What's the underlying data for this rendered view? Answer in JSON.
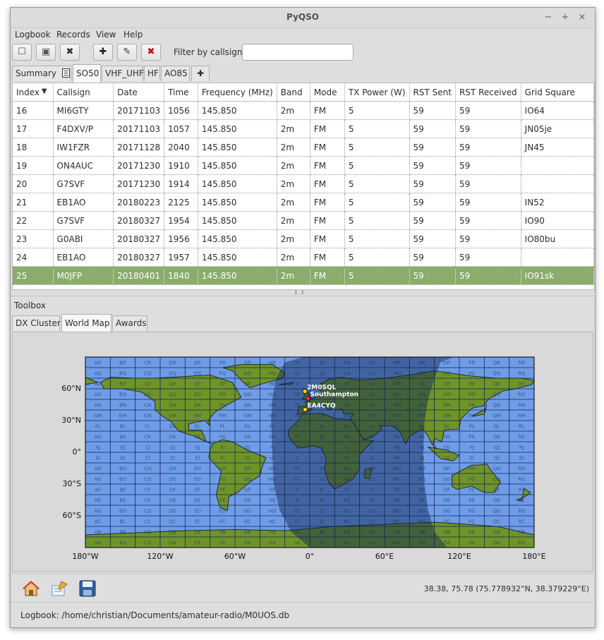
{
  "window": {
    "title": "PyQSO",
    "min_glyph": "−",
    "max_glyph": "+",
    "close_glyph": "×"
  },
  "menubar": {
    "items": [
      "Logbook",
      "Records",
      "View",
      "Help"
    ]
  },
  "toolbar": {
    "buttons": [
      {
        "name": "new-logbook-icon",
        "glyph": "☐",
        "color": "#555555"
      },
      {
        "name": "open-logbook-icon",
        "glyph": "▣",
        "color": "#555555"
      },
      {
        "name": "close-logbook-icon",
        "glyph": "✖",
        "color": "#333333"
      },
      {
        "name": "add-record-icon",
        "glyph": "✚",
        "color": "#222222"
      },
      {
        "name": "edit-record-icon",
        "glyph": "✎",
        "color": "#333333"
      },
      {
        "name": "delete-record-icon",
        "glyph": "✖",
        "color": "#cc0000"
      }
    ],
    "filter_label": "Filter by callsign:",
    "filter_value": ""
  },
  "logbook_tabs": [
    {
      "label": "Summary",
      "has_icon": true,
      "active": false
    },
    {
      "label": "SO50",
      "active": true
    },
    {
      "label": "VHF_UHF",
      "active": false
    },
    {
      "label": "HF",
      "active": false
    },
    {
      "label": "AO85",
      "active": false
    },
    {
      "label": "✚",
      "active": false
    }
  ],
  "table": {
    "sort_indicator": "▼",
    "columns": [
      "Index",
      "Callsign",
      "Date",
      "Time",
      "Frequency (MHz)",
      "Band",
      "Mode",
      "TX Power (W)",
      "RST Sent",
      "RST Received",
      "Grid Square"
    ],
    "rows": [
      [
        "16",
        "MI6GTY",
        "20171103",
        "1056",
        "145.850",
        "2m",
        "FM",
        "5",
        "59",
        "59",
        "IO64"
      ],
      [
        "17",
        "F4DXV/P",
        "20171103",
        "1057",
        "145.850",
        "2m",
        "FM",
        "5",
        "59",
        "59",
        "JN05je"
      ],
      [
        "18",
        "IW1FZR",
        "20171128",
        "2040",
        "145.850",
        "2m",
        "FM",
        "5",
        "59",
        "59",
        "JN45"
      ],
      [
        "19",
        "ON4AUC",
        "20171230",
        "1910",
        "145.850",
        "2m",
        "FM",
        "5",
        "59",
        "59",
        ""
      ],
      [
        "20",
        "G7SVF",
        "20171230",
        "1914",
        "145.850",
        "2m",
        "FM",
        "5",
        "59",
        "59",
        ""
      ],
      [
        "21",
        "EB1AO",
        "20180223",
        "2125",
        "145.850",
        "2m",
        "FM",
        "5",
        "59",
        "59",
        "IN52"
      ],
      [
        "22",
        "G7SVF",
        "20180327",
        "1954",
        "145.850",
        "2m",
        "FM",
        "5",
        "59",
        "59",
        "IO90"
      ],
      [
        "23",
        "G0ABI",
        "20180327",
        "1956",
        "145.850",
        "2m",
        "FM",
        "5",
        "59",
        "59",
        "IO80bu"
      ],
      [
        "24",
        "EB1AO",
        "20180327",
        "1957",
        "145.850",
        "2m",
        "FM",
        "5",
        "59",
        "59",
        ""
      ],
      [
        "25",
        "M0JFP",
        "20180401",
        "1840",
        "145.850",
        "2m",
        "FM",
        "5",
        "59",
        "59",
        "IO91sk"
      ]
    ],
    "selected_index": 9
  },
  "toolbox": {
    "label": "Toolbox",
    "tabs": [
      {
        "label": "DX Cluster",
        "active": false
      },
      {
        "label": "World Map",
        "active": true
      },
      {
        "label": "Awards",
        "active": false
      }
    ]
  },
  "worldmap": {
    "lat_labels": [
      "60°N",
      "30°N",
      "0°",
      "30°S",
      "60°S"
    ],
    "lon_labels": [
      "180°W",
      "120°W",
      "60°W",
      "0°",
      "60°E",
      "120°E",
      "180°E"
    ],
    "grid_cols": [
      "A",
      "B",
      "C",
      "D",
      "E",
      "F",
      "G",
      "H",
      "I",
      "J",
      "K",
      "L",
      "M",
      "N",
      "O",
      "P",
      "Q",
      "R"
    ],
    "grid_rows": [
      "R",
      "Q",
      "P",
      "O",
      "N",
      "M",
      "L",
      "K",
      "J",
      "I",
      "H",
      "G",
      "F",
      "E",
      "D",
      "C",
      "B",
      "A"
    ],
    "markers": [
      {
        "label": "2M0SQL",
        "lat": 57.6,
        "lon": -3.9,
        "color": "#ffd700"
      },
      {
        "label": "Southampton",
        "lat": 50.9,
        "lon": -1.4,
        "color": "#ff2a2a"
      },
      {
        "label": "EA4CYQ",
        "lat": 40.4,
        "lon": -3.7,
        "color": "#ffd700"
      }
    ],
    "colors": {
      "ocean": "#6e9ce6",
      "land": "#6f9428",
      "night": "#0d2450"
    }
  },
  "bottom_tools": {
    "icons": [
      "home-icon",
      "configure-icon",
      "save-icon"
    ],
    "coords_text": "38.38, 75.78 (75.778932°N, 38.379229°E)"
  },
  "statusbar": {
    "text": "Logbook: /home/christian/Documents/amateur-radio/M0UOS.db"
  }
}
